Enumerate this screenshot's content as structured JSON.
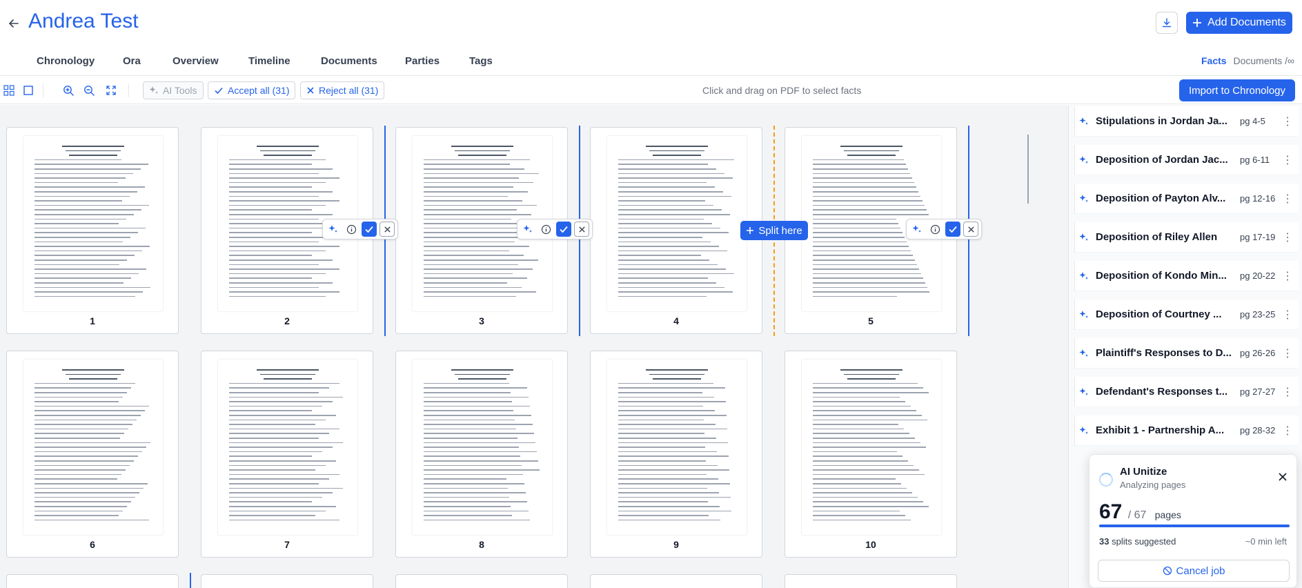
{
  "header": {
    "title": "Andrea Test",
    "add_documents_label": "Add Documents"
  },
  "tabs": [
    "Chronology",
    "Ora",
    "Overview",
    "Timeline",
    "Documents",
    "Parties",
    "Tags"
  ],
  "right_tabs": {
    "facts": "Facts",
    "documents": "Documents /∞"
  },
  "toolbar": {
    "ai_tools_label": "AI Tools",
    "accept_all_label": "Accept all (31)",
    "reject_all_label": "Reject all (31)",
    "hint": "Click and drag on PDF to select facts",
    "import_label": "Import to Chronology"
  },
  "canvas": {
    "split_here_label": "Split here",
    "pages_row1": [
      "1",
      "2",
      "3",
      "4",
      "5"
    ],
    "pages_row2": [
      "6",
      "7",
      "8",
      "9",
      "10"
    ]
  },
  "facts": [
    {
      "title": "Stipulations in Jordan Ja...",
      "pages": "pg 4-5"
    },
    {
      "title": "Deposition of Jordan Jac...",
      "pages": "pg 6-11"
    },
    {
      "title": "Deposition of Payton Alv...",
      "pages": "pg 12-16"
    },
    {
      "title": "Deposition of Riley Allen",
      "pages": "pg 17-19"
    },
    {
      "title": "Deposition of Kondo Min...",
      "pages": "pg 20-22"
    },
    {
      "title": "Deposition of Courtney ...",
      "pages": "pg 23-25"
    },
    {
      "title": "Plaintiff's Responses to D...",
      "pages": "pg 26-26"
    },
    {
      "title": "Defendant's Responses t...",
      "pages": "pg 27-27"
    },
    {
      "title": "Exhibit 1 - Partnership A...",
      "pages": "pg 28-32"
    }
  ],
  "ai_job": {
    "title": "AI Unitize",
    "subtitle": "Analyzing pages",
    "pages_done": "67",
    "pages_total": "/ 67",
    "pages_unit": "pages",
    "progress": 1.0,
    "splits_count": "33",
    "splits_label": "splits suggested",
    "eta": "~0 min left",
    "cancel_label": "Cancel job"
  }
}
